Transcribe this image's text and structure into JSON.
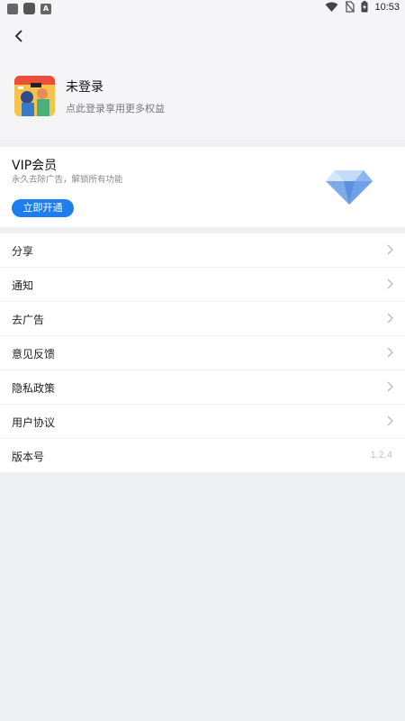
{
  "status_bar": {
    "time": "10:53",
    "left_icons": [
      "image-icon",
      "square-icon",
      "a-icon"
    ],
    "right_icons": [
      "wifi-icon",
      "no-sim-icon",
      "battery-icon"
    ]
  },
  "header": {
    "back_icon": "chevron-left-icon"
  },
  "profile": {
    "name": "未登录",
    "subtitle": "点此登录享用更多权益"
  },
  "vip": {
    "title": "VIP会员",
    "description": "永久去除广告，解锁所有功能",
    "button_label": "立即开通",
    "icon": "diamond-icon",
    "accent_color": "#1e7ef0"
  },
  "menu": {
    "items": [
      {
        "label": "分享"
      },
      {
        "label": "通知"
      },
      {
        "label": "去广告"
      },
      {
        "label": "意见反馈"
      },
      {
        "label": "隐私政策"
      },
      {
        "label": "用户协议"
      }
    ],
    "version": {
      "label": "版本号",
      "value": "1.2.4"
    }
  }
}
